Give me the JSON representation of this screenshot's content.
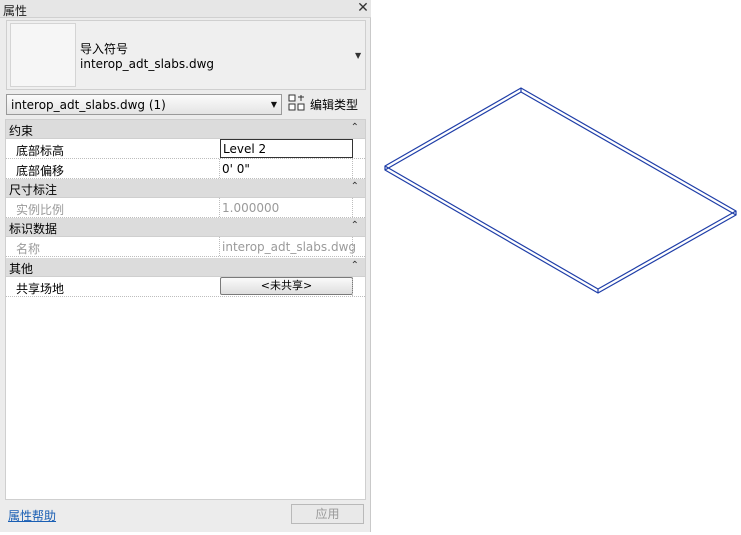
{
  "palette": {
    "title": "属性",
    "close_icon": "✕"
  },
  "type_selector": {
    "category": "导入符号",
    "name": "interop_adt_slabs.dwg"
  },
  "instance_selector": {
    "value": "interop_adt_slabs.dwg (1)"
  },
  "edit_type": {
    "label": "编辑类型"
  },
  "groups": {
    "constraints": {
      "label": "约束",
      "rows": [
        {
          "name": "底部标高",
          "value": "Level 2"
        },
        {
          "name": "底部偏移",
          "value": "0'  0\""
        }
      ]
    },
    "dimensions": {
      "label": "尺寸标注",
      "rows": [
        {
          "name": "实例比例",
          "value": "1.000000"
        }
      ]
    },
    "identity": {
      "label": "标识数据",
      "rows": [
        {
          "name": "名称",
          "value": "interop_adt_slabs.dwg"
        }
      ]
    },
    "other": {
      "label": "其他",
      "rows": [
        {
          "name": "共享场地",
          "value": "<未共享>"
        }
      ]
    }
  },
  "footer": {
    "help_link": "属性帮助",
    "apply_label": "应用"
  },
  "colors": {
    "link": "#1a5fb4",
    "slab_edge": "#1f3ea8"
  }
}
